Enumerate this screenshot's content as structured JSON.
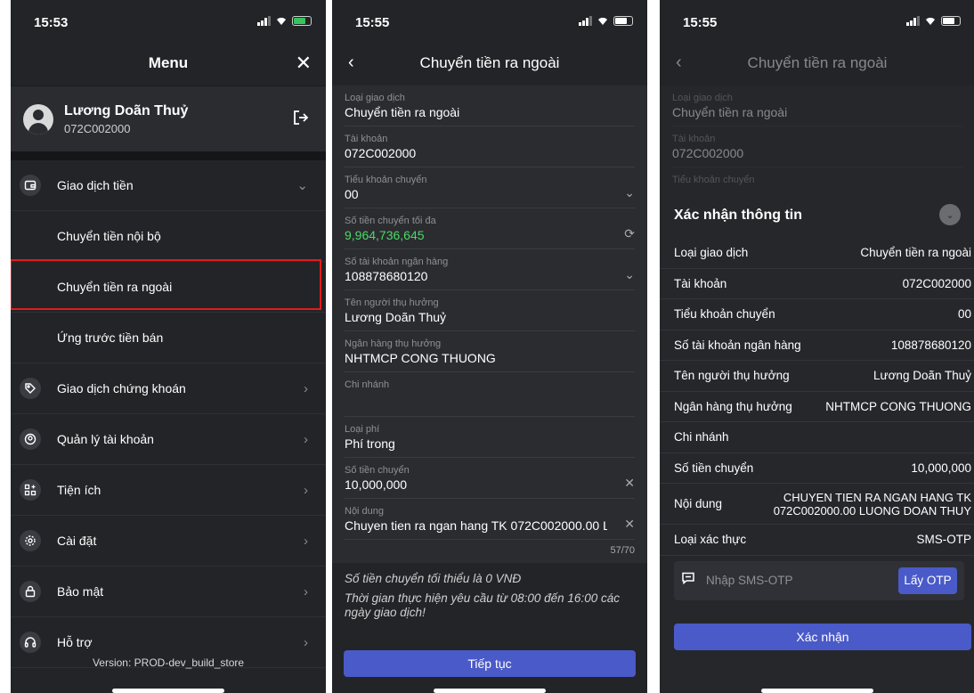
{
  "panel1": {
    "time": "15:53",
    "title": "Menu",
    "user_name": "Lương Doãn Thuỷ",
    "user_account": "072C002000",
    "menu_group1": "Giao dịch tiền",
    "sub_items": [
      "Chuyển tiền nội bộ",
      "Chuyển tiền ra ngoài",
      "Ứng trước tiền bán"
    ],
    "menu_items": [
      "Giao dịch chứng khoán",
      "Quản lý tài khoản",
      "Tiện ích",
      "Cài đặt",
      "Bảo mật",
      "Hỗ trợ"
    ],
    "version": "Version: PROD-dev_build_store"
  },
  "panel2": {
    "time": "15:55",
    "title": "Chuyển tiền ra ngoài",
    "fields": [
      {
        "label": "Loại giao dịch",
        "value": "Chuyển tiền ra ngoài"
      },
      {
        "label": "Tài khoản",
        "value": "072C002000"
      },
      {
        "label": "Tiểu khoản chuyển",
        "value": "00"
      },
      {
        "label": "Số tiền chuyển tối đa",
        "value": "9,964,736,645"
      },
      {
        "label": "Số tài khoản ngân hàng",
        "value": "108878680120"
      },
      {
        "label": "Tên người thụ hưởng",
        "value": "Lương Doãn Thuỷ"
      },
      {
        "label": "Ngân hàng thụ hưởng",
        "value": "NHTMCP CONG THUONG"
      },
      {
        "label": "Chi nhánh",
        "value": ""
      },
      {
        "label": "Loại phí",
        "value": "Phí trong"
      },
      {
        "label": "Số tiền chuyển",
        "value": "10,000,000"
      },
      {
        "label": "Nội dung",
        "value": "Chuyen tien ra ngan hang TK 072C002000.00 L"
      }
    ],
    "counter": "57/70",
    "note1": "Số tiền chuyển tối thiểu là 0 VNĐ",
    "note2": "Thời gian thực hiện yêu cầu từ 08:00 đến 16:00 các ngày giao dịch!",
    "continue_label": "Tiếp tục"
  },
  "panel3": {
    "time": "15:55",
    "title": "Chuyển tiền ra ngoài",
    "bg_fields": [
      {
        "label": "Loại giao dịch",
        "value": "Chuyển tiền ra ngoài"
      },
      {
        "label": "Tài khoản",
        "value": "072C002000"
      },
      {
        "label": "Tiểu khoản chuyển",
        "value": ""
      }
    ],
    "sheet_title": "Xác nhận thông tin",
    "rows": [
      {
        "k": "Loại giao dịch",
        "v": "Chuyển tiền ra ngoài"
      },
      {
        "k": "Tài khoản",
        "v": "072C002000"
      },
      {
        "k": "Tiểu khoản chuyển",
        "v": "00"
      },
      {
        "k": "Số tài khoản ngân hàng",
        "v": "108878680120"
      },
      {
        "k": "Tên người thụ hưởng",
        "v": "Lương Doãn Thuỷ"
      },
      {
        "k": "Ngân hàng thụ hưởng",
        "v": "NHTMCP CONG THUONG"
      },
      {
        "k": "Chi nhánh",
        "v": ""
      },
      {
        "k": "Số tiền chuyển",
        "v": "10,000,000"
      }
    ],
    "content_label": "Nội dung",
    "content_line1": "CHUYEN TIEN RA NGAN HANG TK",
    "content_line2": "072C002000.00 LUONG DOAN THUY",
    "auth_label": "Loại xác thực",
    "auth_value": "SMS-OTP",
    "otp_placeholder": "Nhập SMS-OTP",
    "otp_button": "Lấy OTP",
    "confirm_label": "Xác nhận"
  }
}
